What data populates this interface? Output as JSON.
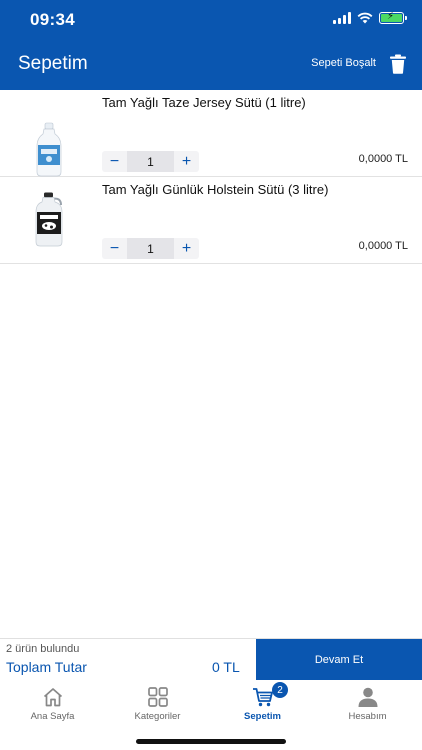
{
  "status_bar": {
    "time": "09:34"
  },
  "header": {
    "title": "Sepetim",
    "clear_label": "Sepeti Boşalt",
    "bg_color": "#0a56b0"
  },
  "cart": {
    "items": [
      {
        "name": "Tam Yağlı Taze Jersey Sütü (1 litre)",
        "quantity": "1",
        "price": "0,0000 TL",
        "decrease": "−",
        "increase": "+"
      },
      {
        "name": "Tam Yağlı Günlük Holstein Sütü (3 litre)",
        "quantity": "1",
        "price": "0,0000 TL",
        "decrease": "−",
        "increase": "+"
      }
    ]
  },
  "summary": {
    "count_text": "2 ürün bulundu",
    "total_label": "Toplam Tutar",
    "total_value": "0 TL",
    "continue_label": "Devam Et"
  },
  "tabbar": {
    "tabs": [
      {
        "label": "Ana Sayfa",
        "icon": "home-icon"
      },
      {
        "label": "Kategoriler",
        "icon": "grid-icon"
      },
      {
        "label": "Sepetim",
        "icon": "cart-icon",
        "badge": "2",
        "active": true
      },
      {
        "label": "Hesabım",
        "icon": "user-icon"
      }
    ]
  }
}
